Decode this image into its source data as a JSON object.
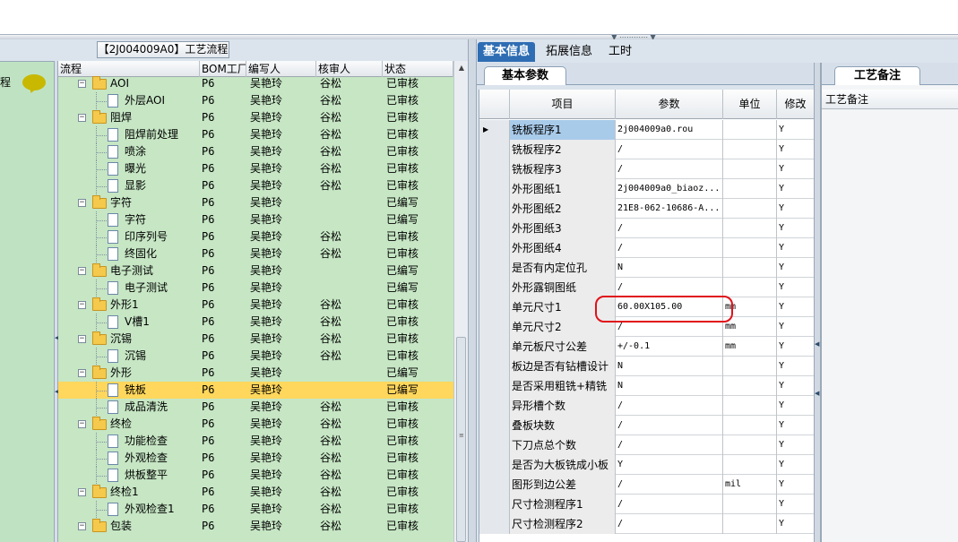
{
  "process_title": "【2J004009A0】工艺流程",
  "left_panel": {
    "label": "程"
  },
  "tree_grid": {
    "columns": [
      "流程",
      "BOM工厂",
      "编写人",
      "核审人",
      "状态"
    ],
    "rows": [
      {
        "name": "AOI",
        "level": 0,
        "type": "folder",
        "factory": "P6",
        "writer": "吴艳玲",
        "reviewer": "谷松",
        "status": "已审核"
      },
      {
        "name": "外层AOI",
        "level": 1,
        "type": "doc",
        "factory": "P6",
        "writer": "吴艳玲",
        "reviewer": "谷松",
        "status": "已审核"
      },
      {
        "name": "阻焊",
        "level": 0,
        "type": "folder",
        "factory": "P6",
        "writer": "吴艳玲",
        "reviewer": "谷松",
        "status": "已审核"
      },
      {
        "name": "阻焊前处理",
        "level": 1,
        "type": "doc",
        "factory": "P6",
        "writer": "吴艳玲",
        "reviewer": "谷松",
        "status": "已审核"
      },
      {
        "name": "喷涂",
        "level": 1,
        "type": "doc",
        "factory": "P6",
        "writer": "吴艳玲",
        "reviewer": "谷松",
        "status": "已审核"
      },
      {
        "name": "曝光",
        "level": 1,
        "type": "doc",
        "factory": "P6",
        "writer": "吴艳玲",
        "reviewer": "谷松",
        "status": "已审核"
      },
      {
        "name": "显影",
        "level": 1,
        "type": "doc",
        "factory": "P6",
        "writer": "吴艳玲",
        "reviewer": "谷松",
        "status": "已审核"
      },
      {
        "name": "字符",
        "level": 0,
        "type": "folder",
        "factory": "P6",
        "writer": "吴艳玲",
        "reviewer": "",
        "status": "已编写"
      },
      {
        "name": "字符",
        "level": 1,
        "type": "doc",
        "factory": "P6",
        "writer": "吴艳玲",
        "reviewer": "",
        "status": "已编写"
      },
      {
        "name": "印序列号",
        "level": 1,
        "type": "doc",
        "factory": "P6",
        "writer": "吴艳玲",
        "reviewer": "谷松",
        "status": "已审核"
      },
      {
        "name": "终固化",
        "level": 1,
        "type": "doc",
        "factory": "P6",
        "writer": "吴艳玲",
        "reviewer": "谷松",
        "status": "已审核"
      },
      {
        "name": "电子测试",
        "level": 0,
        "type": "folder",
        "factory": "P6",
        "writer": "吴艳玲",
        "reviewer": "",
        "status": "已编写"
      },
      {
        "name": "电子测试",
        "level": 1,
        "type": "doc",
        "factory": "P6",
        "writer": "吴艳玲",
        "reviewer": "",
        "status": "已编写"
      },
      {
        "name": "外形1",
        "level": 0,
        "type": "folder",
        "factory": "P6",
        "writer": "吴艳玲",
        "reviewer": "谷松",
        "status": "已审核"
      },
      {
        "name": "V槽1",
        "level": 1,
        "type": "doc",
        "factory": "P6",
        "writer": "吴艳玲",
        "reviewer": "谷松",
        "status": "已审核"
      },
      {
        "name": "沉锡",
        "level": 0,
        "type": "folder",
        "factory": "P6",
        "writer": "吴艳玲",
        "reviewer": "谷松",
        "status": "已审核"
      },
      {
        "name": "沉锡",
        "level": 1,
        "type": "doc",
        "factory": "P6",
        "writer": "吴艳玲",
        "reviewer": "谷松",
        "status": "已审核"
      },
      {
        "name": "外形",
        "level": 0,
        "type": "folder",
        "factory": "P6",
        "writer": "吴艳玲",
        "reviewer": "",
        "status": "已编写"
      },
      {
        "name": "铣板",
        "level": 1,
        "type": "doc",
        "factory": "P6",
        "writer": "吴艳玲",
        "reviewer": "",
        "status": "已编写",
        "selected": true
      },
      {
        "name": "成品清洗",
        "level": 1,
        "type": "doc",
        "factory": "P6",
        "writer": "吴艳玲",
        "reviewer": "谷松",
        "status": "已审核"
      },
      {
        "name": "终检",
        "level": 0,
        "type": "folder",
        "factory": "P6",
        "writer": "吴艳玲",
        "reviewer": "谷松",
        "status": "已审核"
      },
      {
        "name": "功能检查",
        "level": 1,
        "type": "doc",
        "factory": "P6",
        "writer": "吴艳玲",
        "reviewer": "谷松",
        "status": "已审核"
      },
      {
        "name": "外观检查",
        "level": 1,
        "type": "doc",
        "factory": "P6",
        "writer": "吴艳玲",
        "reviewer": "谷松",
        "status": "已审核"
      },
      {
        "name": "烘板整平",
        "level": 1,
        "type": "doc",
        "factory": "P6",
        "writer": "吴艳玲",
        "reviewer": "谷松",
        "status": "已审核"
      },
      {
        "name": "终检1",
        "level": 0,
        "type": "folder",
        "factory": "P6",
        "writer": "吴艳玲",
        "reviewer": "谷松",
        "status": "已审核"
      },
      {
        "name": "外观检查1",
        "level": 1,
        "type": "doc",
        "factory": "P6",
        "writer": "吴艳玲",
        "reviewer": "谷松",
        "status": "已审核"
      },
      {
        "name": "包装",
        "level": 0,
        "type": "folder",
        "factory": "P6",
        "writer": "吴艳玲",
        "reviewer": "谷松",
        "status": "已审核"
      }
    ]
  },
  "right_tabs": [
    "基本信息",
    "拓展信息",
    "工时"
  ],
  "sub_tab": "基本参数",
  "param_grid": {
    "columns": [
      "项目",
      "参数",
      "单位",
      "修改"
    ],
    "rows": [
      {
        "item": "铣板程序1",
        "param": "2j004009a0.rou",
        "unit": "",
        "mod": "Y",
        "current": true
      },
      {
        "item": "铣板程序2",
        "param": "/",
        "unit": "",
        "mod": "Y"
      },
      {
        "item": "铣板程序3",
        "param": "/",
        "unit": "",
        "mod": "Y"
      },
      {
        "item": "外形图纸1",
        "param": "2j004009a0_biaoz...",
        "unit": "",
        "mod": "Y"
      },
      {
        "item": "外形图纸2",
        "param": "21E8-062-10686-A...",
        "unit": "",
        "mod": "Y"
      },
      {
        "item": "外形图纸3",
        "param": "/",
        "unit": "",
        "mod": "Y"
      },
      {
        "item": "外形图纸4",
        "param": "/",
        "unit": "",
        "mod": "Y"
      },
      {
        "item": "是否有内定位孔",
        "param": "N",
        "unit": "",
        "mod": "Y"
      },
      {
        "item": "外形露铜图纸",
        "param": "/",
        "unit": "",
        "mod": "Y"
      },
      {
        "item": "单元尺寸1",
        "param": "60.00X105.00",
        "unit": "mm",
        "mod": "Y"
      },
      {
        "item": "单元尺寸2",
        "param": "/",
        "unit": "mm",
        "mod": "Y"
      },
      {
        "item": "单元板尺寸公差",
        "param": "+/-0.1",
        "unit": "mm",
        "mod": "Y"
      },
      {
        "item": "板边是否有钻槽设计",
        "param": "N",
        "unit": "",
        "mod": "Y"
      },
      {
        "item": "是否采用粗铣+精铣",
        "param": "N",
        "unit": "",
        "mod": "Y"
      },
      {
        "item": "异形槽个数",
        "param": "/",
        "unit": "",
        "mod": "Y"
      },
      {
        "item": "叠板块数",
        "param": "/",
        "unit": "",
        "mod": "Y"
      },
      {
        "item": "下刀点总个数",
        "param": "/",
        "unit": "",
        "mod": "Y"
      },
      {
        "item": "是否为大板铣成小板",
        "param": "Y",
        "unit": "",
        "mod": "Y"
      },
      {
        "item": "图形到边公差",
        "param": "/",
        "unit": "mil",
        "mod": "Y"
      },
      {
        "item": "尺寸检测程序1",
        "param": "/",
        "unit": "",
        "mod": "Y"
      },
      {
        "item": "尺寸检测程序2",
        "param": "/",
        "unit": "",
        "mod": "Y"
      }
    ]
  },
  "notes_panel": {
    "tab": "工艺备注",
    "header": "工艺备注"
  },
  "colors": {
    "tree_bg": "#c6e6c4",
    "selected_row": "#ffd75c",
    "tab_active": "#2e6db3",
    "highlight_circle": "#e0121a"
  }
}
